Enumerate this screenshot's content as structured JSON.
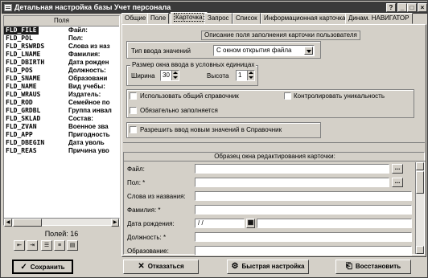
{
  "window": {
    "title": "Детальная настройка базы Учет персонала",
    "controls": {
      "help": "?",
      "minimize": "_",
      "maximize": "□",
      "close": "×"
    }
  },
  "fields_panel": {
    "header": "Поля",
    "items": [
      {
        "name": "FLD_FILE",
        "caption": "Файл:"
      },
      {
        "name": "FLD_POL",
        "caption": "Пол:"
      },
      {
        "name": "FLD_RSWRDS",
        "caption": "Слова из наз"
      },
      {
        "name": "FLD_LNAME",
        "caption": "Фамилия:"
      },
      {
        "name": "FLD_DBIRTH",
        "caption": "Дата рожден"
      },
      {
        "name": "FLD_POS",
        "caption": "Должность:"
      },
      {
        "name": "FLD_SNAME",
        "caption": "Образовани"
      },
      {
        "name": "FLD_NAME",
        "caption": "Вид учебы:"
      },
      {
        "name": "FLD_WRAUS",
        "caption": "Издатель:"
      },
      {
        "name": "FLD_ROD",
        "caption": "Семейное по"
      },
      {
        "name": "FLD_GRDBL",
        "caption": "Группа инвал"
      },
      {
        "name": "FLD_SKLAD",
        "caption": "Состав:"
      },
      {
        "name": "FLD_ZVAN",
        "caption": "Военное зва"
      },
      {
        "name": "FLD_APP",
        "caption": "Пригодность"
      },
      {
        "name": "FLD_DBEGIN",
        "caption": "Дата уволь"
      },
      {
        "name": "FLD_REAS",
        "caption": "Причина уво"
      }
    ],
    "selected_index": 0,
    "count_label": "Полей: 16"
  },
  "tabs": [
    {
      "label": "Общие"
    },
    {
      "label": "Поле"
    },
    {
      "label": "Карточка"
    },
    {
      "label": "Запрос"
    },
    {
      "label": "Список"
    },
    {
      "label": "Информационная карточка"
    },
    {
      "label": "Динам. НАВИГАТОР"
    }
  ],
  "active_tab": "Карточка",
  "card_settings": {
    "section_title": "Описание поля заполнения карточки пользователя",
    "value_type_label": "Тип ввода значений",
    "value_type_value": "С окном открытия файла",
    "size_group_label": "Размер окна ввода в условных единицах",
    "width_label": "Ширина",
    "width_value": "30",
    "height_label": "Высота",
    "height_value": "1",
    "use_ref_label": "Использовать общий справочник",
    "control_unique_label": "Контролировать уникальность",
    "required_label": "Обязательно заполняется",
    "allow_new_label": "Разрешить ввод новым значений в Справочник"
  },
  "preview": {
    "title": "Образец окна редактирования карточки:",
    "fields": [
      {
        "label": "Файл:",
        "value": "",
        "has_button": true
      },
      {
        "label": "Пол: *",
        "value": "",
        "has_button": true
      },
      {
        "label": "Слова из названия:",
        "value": "",
        "has_button": false
      },
      {
        "label": "Фамилия: *",
        "value": "",
        "has_button": false
      },
      {
        "label": "Дата рождения:",
        "value": "  /  /",
        "has_button": false
      },
      {
        "label": "Должность: *",
        "value": "",
        "has_button": false
      },
      {
        "label": "Образование:",
        "value": "",
        "has_button": false
      }
    ],
    "ellipsis": "..."
  },
  "buttons": {
    "save": "Сохранить",
    "cancel": "Отказаться",
    "quick_setup": "Быстрая настройка",
    "restore": "Восстановить"
  },
  "icons": {
    "save": "check-icon",
    "cancel": "x-icon",
    "quick_setup": "gear-icon",
    "restore": "restore-icon"
  }
}
